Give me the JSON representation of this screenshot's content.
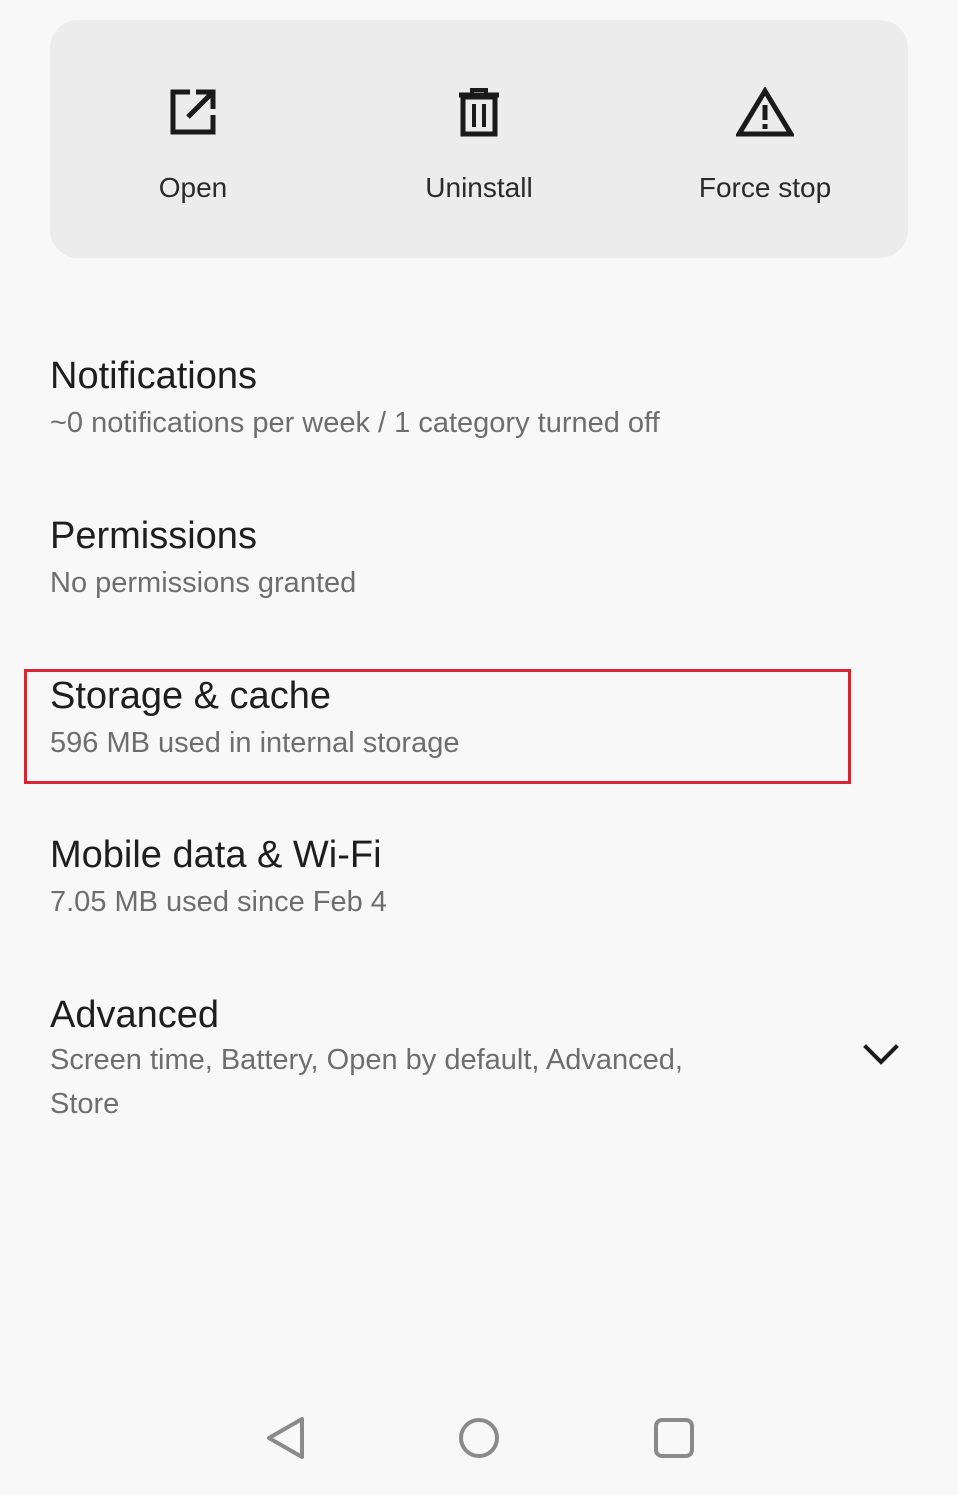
{
  "actions": {
    "open_label": "Open",
    "uninstall_label": "Uninstall",
    "force_stop_label": "Force stop"
  },
  "items": [
    {
      "title": "Notifications",
      "subtitle": "~0 notifications per week / 1 category turned off"
    },
    {
      "title": "Permissions",
      "subtitle": "No permissions granted"
    },
    {
      "title": "Storage & cache",
      "subtitle": "596 MB used in internal storage"
    },
    {
      "title": "Mobile data & Wi-Fi",
      "subtitle": "7.05 MB used since Feb 4"
    },
    {
      "title": "Advanced",
      "subtitle": "Screen time, Battery, Open by default, Advanced,",
      "subtitle2": "Store"
    }
  ],
  "icons": {
    "open": "open-external-icon",
    "uninstall": "trash-icon",
    "force_stop": "warning-icon",
    "expand": "chevron-down-icon",
    "nav_back": "back-icon",
    "nav_home": "home-icon",
    "nav_recents": "recents-icon"
  },
  "colors": {
    "highlight": "#d32733",
    "card_bg": "#ececec",
    "page_bg": "#f8f8f8"
  }
}
